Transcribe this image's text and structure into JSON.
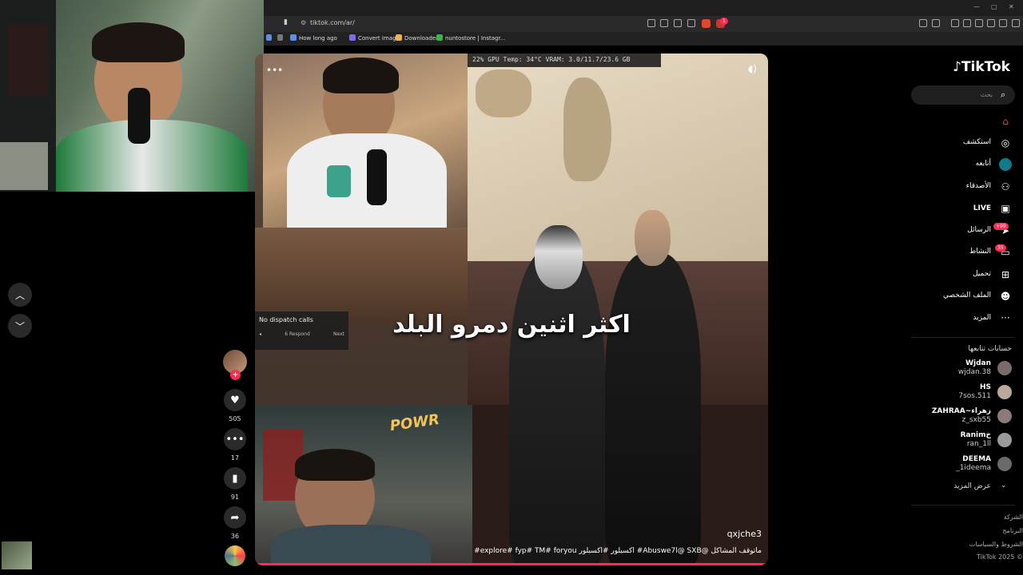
{
  "browser": {
    "url": "tiktok.com/ar/",
    "bookmarks": [
      {
        "label": "How long ago",
        "color": "#5b8def"
      },
      {
        "label": "Convert Image",
        "color": "#7b6cf0"
      },
      {
        "label": "Downloader",
        "color": "#f0b24a"
      },
      {
        "label": "nuntostore | Instagr...",
        "color": "#3bb54a"
      }
    ],
    "notification_count": "1"
  },
  "video": {
    "gpu_stats": "22%   GPU Temp: 34°C  VRAM: 3.0/11.7/23.6 GB",
    "dispatch_title": "No dispatch calls",
    "dispatch_respond": "Respond",
    "dispatch_respond_key": "6",
    "dispatch_next": "Next",
    "caption": "اكثر اثنين دمرو البلد",
    "author": "qxjche3",
    "description": "ماتوقف المشاكل @Abuswe7l@ SXB# اكسبلور #اكسبلور explore# fyp# TM# foryou#",
    "overlay_sign": "POWR",
    "progress": 0.99
  },
  "actions": {
    "likes": "505",
    "comments": "17",
    "saves": "91",
    "shares": "36"
  },
  "sidebar": {
    "logo": "TikTok",
    "search_placeholder": "بحث",
    "nav": [
      {
        "label": "",
        "icon": "home-icon",
        "active": true
      },
      {
        "label": "استكشف",
        "icon": "compass-icon"
      },
      {
        "label": "أتابعه",
        "icon": "following-avatar-icon"
      },
      {
        "label": "الأصدقاء",
        "icon": "friends-icon"
      },
      {
        "label": "LIVE",
        "icon": "live-icon"
      },
      {
        "label": "الرسائل",
        "icon": "messages-icon",
        "badge": "+99"
      },
      {
        "label": "النشاط",
        "icon": "activity-icon",
        "badge": "35"
      },
      {
        "label": "تحميل",
        "icon": "upload-icon"
      },
      {
        "label": "الملف الشخصي",
        "icon": "profile-icon"
      },
      {
        "label": "المزيد",
        "icon": "more-icon"
      }
    ],
    "following_title": "حسابات تتابعها",
    "accounts": [
      {
        "name": "Wjdan",
        "handle": "wjdan.38"
      },
      {
        "name": "HS",
        "handle": "7sos.511"
      },
      {
        "name": "ZAHRAA~زهراء",
        "handle": "z_sxb55"
      },
      {
        "name": "Ranimخ",
        "handle": "ran_1ll"
      },
      {
        "name": "DEEMA",
        "handle": "_1ideema"
      }
    ],
    "see_more": "عرض المزيد",
    "footer": [
      "الشركة",
      "البرنامج",
      "الشروط والسياسات",
      "TikTok 2025 ©"
    ]
  },
  "colors": {
    "accent": "#fe2c55",
    "background": "#000000",
    "surface": "#2a2a2a"
  }
}
